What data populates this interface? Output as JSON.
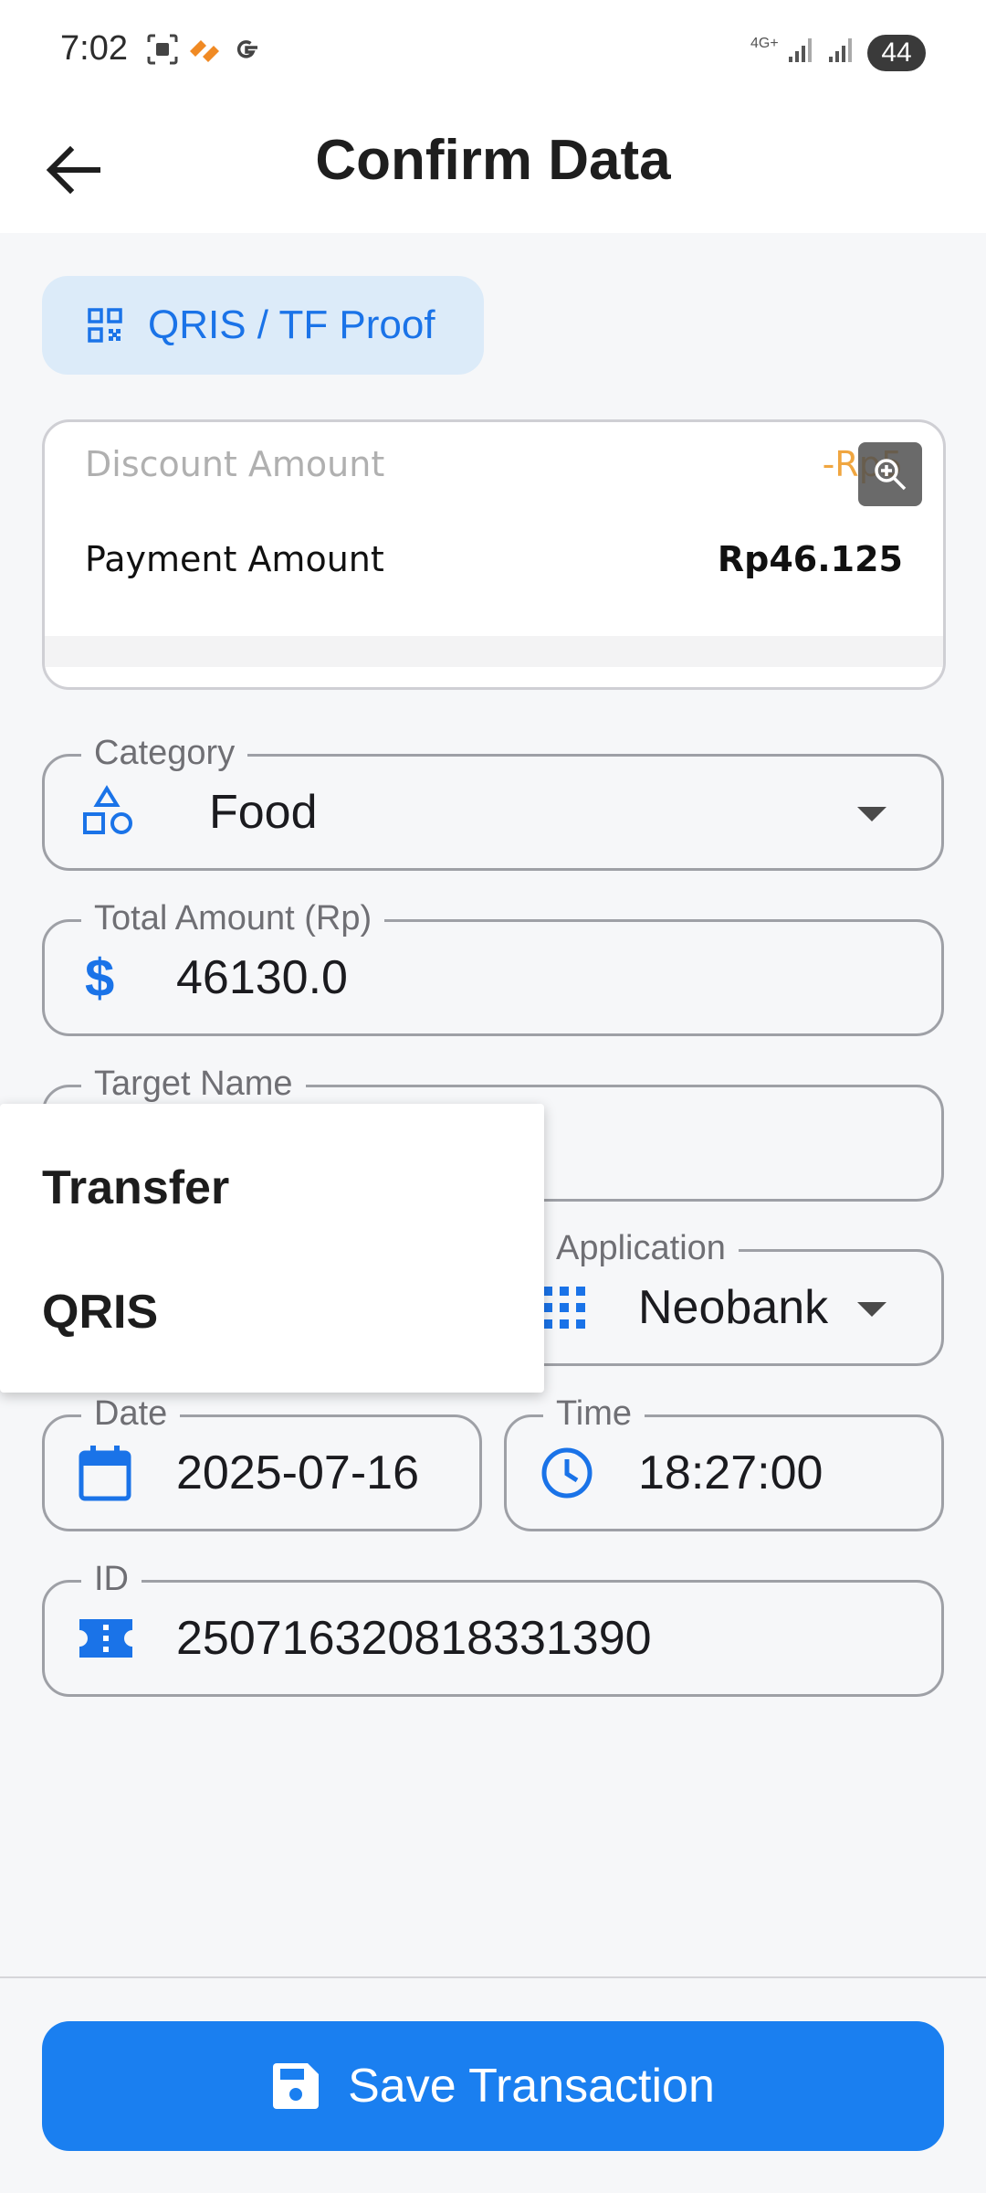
{
  "status_bar": {
    "time": "7:02",
    "network": "4G+",
    "battery": "44",
    "icons": [
      "screenshot-icon",
      "app-notification-icon",
      "google-icon",
      "signal-icon",
      "battery-icon"
    ]
  },
  "app_bar": {
    "title": "Confirm Data",
    "back_icon": "arrow-left-icon"
  },
  "proof_button": {
    "label": "QRIS / TF Proof",
    "icon": "qr-code-icon"
  },
  "receipt_preview": {
    "discount_label": "Discount Amount",
    "discount_value": "-Rp5",
    "payment_label": "Payment Amount",
    "payment_value": "Rp46.125"
  },
  "form": {
    "category": {
      "label": "Category",
      "value": "Food",
      "icon": "shapes-icon"
    },
    "total_amount": {
      "label": "Total Amount (Rp)",
      "value": "46130.0",
      "icon": "dollar-icon"
    },
    "target_name": {
      "label": "Target Name",
      "value": ""
    },
    "application": {
      "label": "Application",
      "value": "Neobank",
      "icon": "apps-grid-icon"
    },
    "date": {
      "label": "Date",
      "value": "2025-07-16",
      "icon": "calendar-icon"
    },
    "time": {
      "label": "Time",
      "value": "18:27:00",
      "icon": "clock-icon"
    },
    "id": {
      "label": "ID",
      "value": "250716320818331390",
      "icon": "ticket-icon"
    }
  },
  "dropdown_menu": {
    "items": [
      {
        "label": "Transfer"
      },
      {
        "label": "QRIS"
      }
    ]
  },
  "save_button": {
    "label": "Save Transaction",
    "icon": "save-icon"
  },
  "colors": {
    "accent": "#1a7ff0",
    "accent_light": "#dcebf9",
    "discount": "#f0a640",
    "background": "#f6f7f9"
  }
}
